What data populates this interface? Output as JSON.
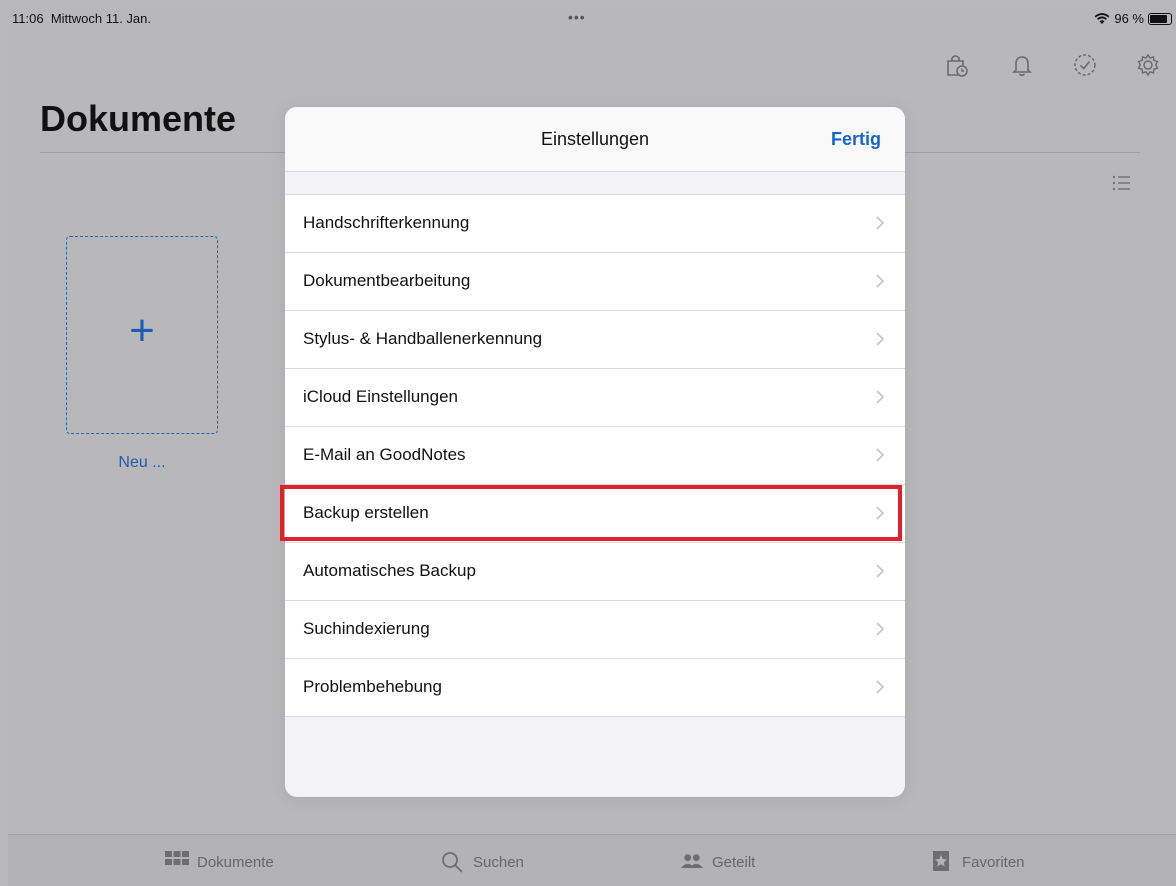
{
  "status_bar": {
    "time": "11:06",
    "date": "Mittwoch 11. Jan.",
    "battery": "96 %",
    "battery_level": 0.96
  },
  "page": {
    "title": "Dokumente",
    "new_label": "Neu ..."
  },
  "header_icons": [
    "shopping-bag-clock-icon",
    "bell-icon",
    "check-circle-icon",
    "gear-icon"
  ],
  "modal": {
    "title": "Einstellungen",
    "done_label": "Fertig",
    "items": [
      {
        "label": "Handschrifterkennung"
      },
      {
        "label": "Dokumentbearbeitung"
      },
      {
        "label": "Stylus- & Handballenerkennung"
      },
      {
        "label": "iCloud Einstellungen"
      },
      {
        "label": "E-Mail an GoodNotes"
      },
      {
        "label": "Backup erstellen",
        "highlighted": true
      },
      {
        "label": "Automatisches Backup"
      },
      {
        "label": "Suchindexierung"
      },
      {
        "label": "Problembehebung"
      }
    ]
  },
  "tabbar": {
    "items": [
      {
        "label": "Dokumente",
        "icon": "grid-icon"
      },
      {
        "label": "Suchen",
        "icon": "search-icon"
      },
      {
        "label": "Geteilt",
        "icon": "people-icon"
      },
      {
        "label": "Favoriten",
        "icon": "star-bookmark-icon"
      }
    ]
  },
  "colors": {
    "accent": "#1765d4",
    "highlight": "#e0202b",
    "backdrop": "#b8b8bb"
  }
}
